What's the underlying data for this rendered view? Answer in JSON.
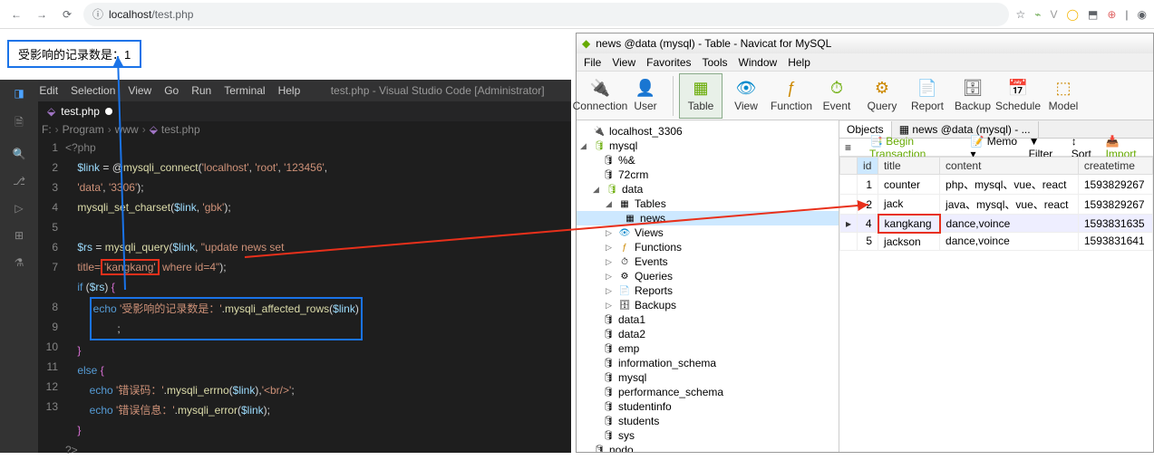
{
  "browser": {
    "url_prefix": "localhost",
    "url_path": "/test.php"
  },
  "page": {
    "result_text": "受影响的记录数是：1"
  },
  "vscode": {
    "menus": [
      "File",
      "Edit",
      "Selection",
      "View",
      "Go",
      "Run",
      "Terminal",
      "Help"
    ],
    "title": "test.php - Visual Studio Code [Administrator]",
    "tab": "test.php",
    "breadcrumb": [
      "F:",
      "Program",
      "www",
      "",
      "test.php"
    ],
    "lines": [
      "1",
      "2",
      "3",
      "4",
      "5",
      "6",
      "7",
      "8",
      "9",
      "10",
      "11",
      "12",
      "13"
    ],
    "code": {
      "l1": "<?php",
      "l2a": "$link",
      "l2b": " = @",
      "l2c": "mysqli_connect",
      "l2d": "(",
      "l2e": "'localhost'",
      "l2f": ", ",
      "l2g": "'root'",
      "l2h": ", ",
      "l2i": "'123456'",
      "l2j": ",",
      "l2k": "'data'",
      "l2l": ", ",
      "l2m": "'3306'",
      "l2n": ");",
      "l3a": "mysqli_set_charset",
      "l3b": "(",
      "l3c": "$link",
      "l3d": ", ",
      "l3e": "'gbk'",
      "l3f": ");",
      "l5a": "$rs",
      "l5b": " = ",
      "l5c": "mysqli_query",
      "l5d": "(",
      "l5e": "$link",
      "l5f": ", ",
      "l5g": "\"update news set ",
      "l5h": "title=",
      "l5i": "'kangkang'",
      "l5j": " where id=4\"",
      "l5k": ");",
      "l6a": "if",
      "l6b": " (",
      "l6c": "$rs",
      "l6d": ") ",
      "l6e": "{",
      "l7a": "echo ",
      "l7b": "'受影响的记录数是：'",
      "l7c": ".",
      "l7d": "mysqli_affected_rows",
      "l7e": "(",
      "l7f": "$link",
      "l7g": ")",
      "l7h": ";",
      "l8a": "}",
      "l9a": "else",
      "l9b": " {",
      "l10a": "echo ",
      "l10b": "'错误码：'",
      "l10c": ".",
      "l10d": "mysqli_errno",
      "l10e": "(",
      "l10f": "$link",
      "l10g": "),",
      "l10h": "'<br/>'",
      "l10i": ";",
      "l11a": "echo ",
      "l11b": "'错误信息：'",
      "l11c": ".",
      "l11d": "mysqli_error",
      "l11e": "(",
      "l11f": "$link",
      "l11g": ");",
      "l12a": "}",
      "l13": "?>"
    }
  },
  "navicat": {
    "title": "news @data (mysql) - Table - Navicat for MySQL",
    "menus": [
      "File",
      "View",
      "Favorites",
      "Tools",
      "Window",
      "Help"
    ],
    "tools": [
      "Connection",
      "User",
      "Table",
      "View",
      "Function",
      "Event",
      "Query",
      "Report",
      "Backup",
      "Schedule",
      "Model"
    ],
    "tree": {
      "root": "localhost_3306",
      "db_mysql": "mysql",
      "n1": "%&",
      "n2": "72crm",
      "db_data": "data",
      "tables": "Tables",
      "news": "news",
      "views": "Views",
      "functions": "Functions",
      "events": "Events",
      "queries": "Queries",
      "reports": "Reports",
      "backups": "Backups",
      "d1": "data1",
      "d2": "data2",
      "d3": "emp",
      "d4": "information_schema",
      "d5": "mysql",
      "d6": "performance_schema",
      "d7": "studentinfo",
      "d8": "students",
      "d9": "sys",
      "d10": "nodo"
    },
    "obj_tabs": {
      "objects": "Objects",
      "news": "news @data (mysql) - ..."
    },
    "tbl_tools": {
      "hamburger": "≡",
      "begin": "Begin Transaction",
      "memo": "Memo",
      "filter": "Filter",
      "sort": "Sort",
      "import": "Import"
    },
    "cols": [
      "id",
      "title",
      "content",
      "createtime"
    ],
    "rows": [
      {
        "id": "1",
        "title": "counter",
        "content": "php、mysql、vue、react",
        "ct": "1593829267"
      },
      {
        "id": "2",
        "title": "jack",
        "content": "java、mysql、vue、react",
        "ct": "1593829267"
      },
      {
        "id": "4",
        "title": "kangkang",
        "content": "dance,voince",
        "ct": "1593831635"
      },
      {
        "id": "5",
        "title": "jackson",
        "content": "dance,voince",
        "ct": "1593831641"
      }
    ]
  }
}
